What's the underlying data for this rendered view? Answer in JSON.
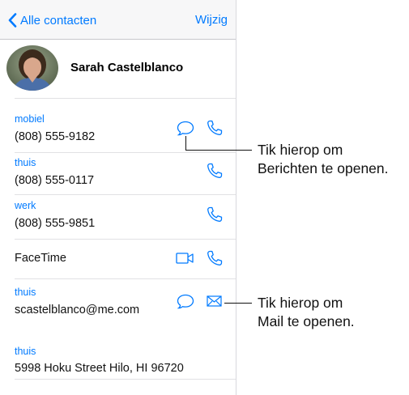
{
  "navbar": {
    "back_label": "Alle contacten",
    "edit_label": "Wijzig"
  },
  "contact": {
    "name": "Sarah Castelblanco"
  },
  "fields": [
    {
      "label": "mobiel",
      "value": "(808) 555-9182"
    },
    {
      "label": "thuis",
      "value": "(808) 555-0117"
    },
    {
      "label": "werk",
      "value": "(808) 555-9851"
    },
    {
      "label": "",
      "value": "FaceTime"
    },
    {
      "label": "thuis",
      "value": "scastelblanco@me.com"
    },
    {
      "label": "thuis",
      "value": "5998 Hoku Street Hilo, HI 96720"
    }
  ],
  "callouts": {
    "messages_line1": "Tik hierop om",
    "messages_line2": "Berichten te openen.",
    "mail_line1": "Tik hierop om",
    "mail_line2": "Mail te openen."
  },
  "colors": {
    "accent": "#007aff",
    "separator": "#e1e1e4",
    "navbar_bg": "#f7f7f8"
  },
  "icons": [
    "chevron-left-icon",
    "message-icon",
    "phone-icon",
    "video-icon",
    "mail-icon"
  ]
}
